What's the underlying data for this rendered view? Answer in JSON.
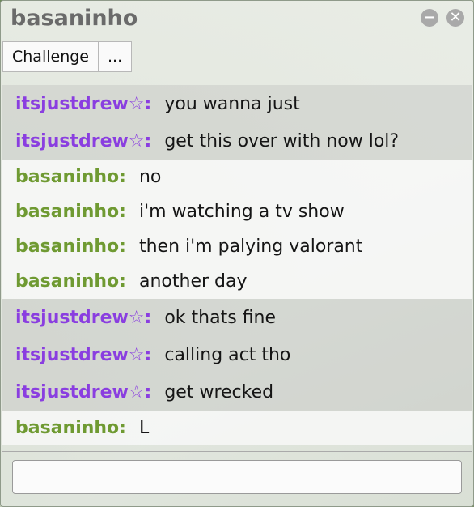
{
  "window": {
    "title": "basaninho"
  },
  "toolbar": {
    "challenge_label": "Challenge",
    "more_label": "..."
  },
  "colors": {
    "opponent_name": "#8a3ee0",
    "self_name": "#6f9a32"
  },
  "icons": {
    "minimize": "minus-circle-icon",
    "close": "close-circle-icon"
  },
  "messages": [
    {
      "name": "itsjustdrew☆:",
      "text": "you wanna just"
    },
    {
      "name": "itsjustdrew☆:",
      "text": "get this over with now lol?"
    },
    {
      "name": "basaninho:",
      "text": "no"
    },
    {
      "name": "basaninho:",
      "text": "i'm watching a tv show"
    },
    {
      "name": "basaninho:",
      "text": "then i'm palying valorant"
    },
    {
      "name": "basaninho:",
      "text": "another day"
    },
    {
      "name": "itsjustdrew☆:",
      "text": "ok thats fine"
    },
    {
      "name": "itsjustdrew☆:",
      "text": "calling act tho"
    },
    {
      "name": "itsjustdrew☆:",
      "text": "get wrecked"
    },
    {
      "name": "basaninho:",
      "text": "L"
    }
  ],
  "chat_input": {
    "value": "",
    "placeholder": ""
  }
}
